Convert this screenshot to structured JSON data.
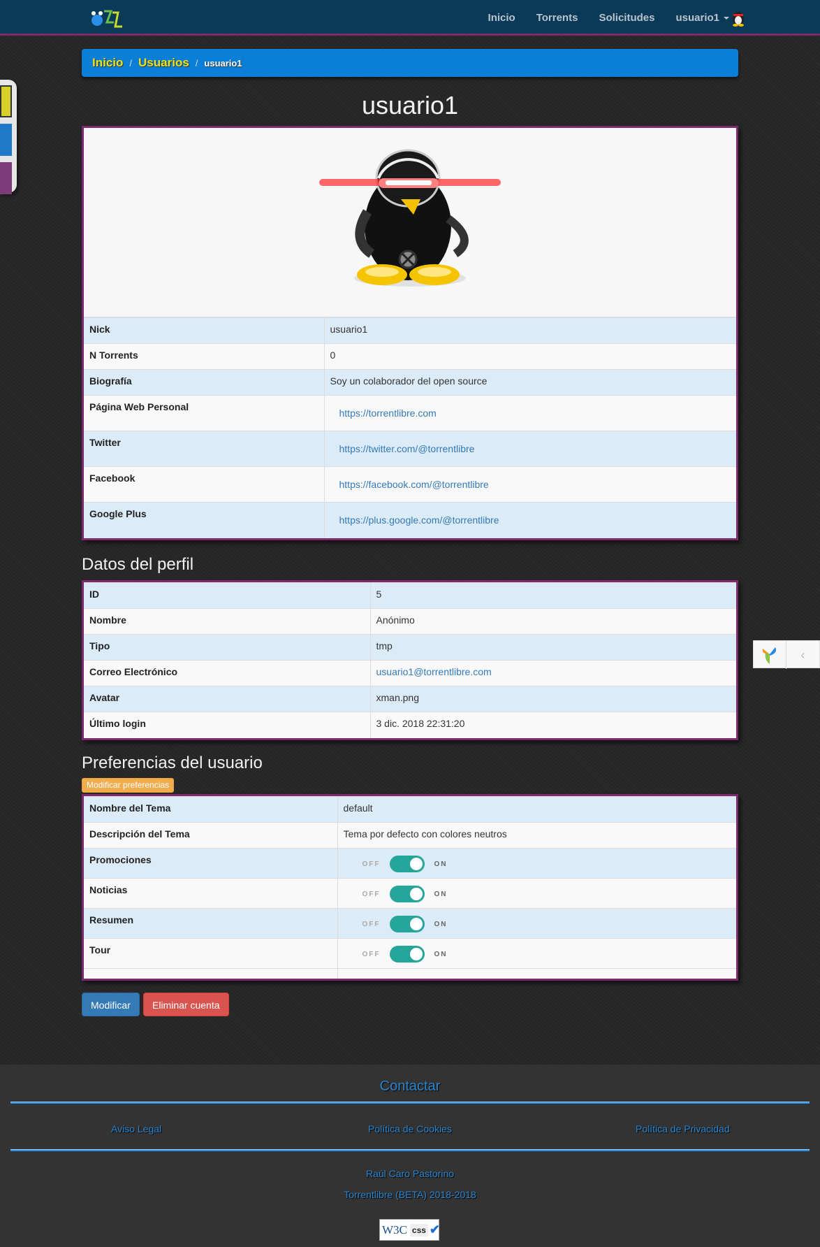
{
  "nav": {
    "items": [
      "Inicio",
      "Torrents",
      "Solicitudes"
    ],
    "user": "usuario1"
  },
  "breadcrumb": {
    "home": "Inicio",
    "users": "Usuarios",
    "current": "usuario1"
  },
  "page_title": "usuario1",
  "profile_table": [
    {
      "label": "Nick",
      "value": "usuario1"
    },
    {
      "label": "N Torrents",
      "value": "0"
    },
    {
      "label": "Biografía",
      "value": "Soy un colaborador del open source"
    },
    {
      "label": "Página Web Personal",
      "value": "https://torrentlibre.com"
    },
    {
      "label": "Twitter",
      "value": "https://twitter.com/@torrentlibre"
    },
    {
      "label": "Facebook",
      "value": "https://facebook.com/@torrentlibre"
    },
    {
      "label": "Google Plus",
      "value": "https://plus.google.com/@torrentlibre"
    }
  ],
  "profile_data": {
    "title": "Datos del perfil",
    "rows": [
      {
        "label": "ID",
        "value": "5"
      },
      {
        "label": "Nombre",
        "value": "Anónimo"
      },
      {
        "label": "Tipo",
        "value": "tmp"
      },
      {
        "label": "Correo Electrónico",
        "value": "usuario1@torrentlibre.com"
      },
      {
        "label": "Avatar",
        "value": "xman.png"
      },
      {
        "label": "Último login",
        "value": "3 dic. 2018 22:31:20"
      }
    ]
  },
  "preferences": {
    "title": "Preferencias del usuario",
    "modify_button": "Modificar preferencias",
    "rows": [
      {
        "label": "Nombre del Tema",
        "value": "default"
      },
      {
        "label": "Descripción del Tema",
        "value": "Tema por defecto con colores neutros"
      }
    ],
    "toggles": [
      {
        "label": "Promociones",
        "off": "OFF",
        "on": "ON",
        "state": true
      },
      {
        "label": "Noticias",
        "off": "OFF",
        "on": "ON",
        "state": true
      },
      {
        "label": "Resumen",
        "off": "OFF",
        "on": "ON",
        "state": true
      },
      {
        "label": "Tour",
        "off": "OFF",
        "on": "ON",
        "state": true
      }
    ]
  },
  "actions": {
    "modify": "Modificar",
    "delete": "Eliminar cuenta"
  },
  "footer": {
    "contact": "Contactar",
    "links": [
      "Aviso Legal",
      "Política de Cookies",
      "Política de Privacidad"
    ],
    "author": "Raúl Caro Pastorino",
    "copyright": "Torrentlibre (BETA) 2018-2018",
    "badge": {
      "w3c": "W3C",
      "css": "css"
    }
  },
  "icons": {
    "brand": "torrentlibre-logo-icon",
    "nav_avatar": "user-avatar-icon",
    "yii": "yii-logo-icon",
    "collapse": "chevron-left-icon"
  },
  "colors": {
    "navbar": "#0a3a57",
    "accent_border": "#7b2a6d",
    "breadcrumb": "#0b7fd8",
    "breadcrumb_link": "#f0e20c",
    "toggle_on": "#26a69a"
  }
}
